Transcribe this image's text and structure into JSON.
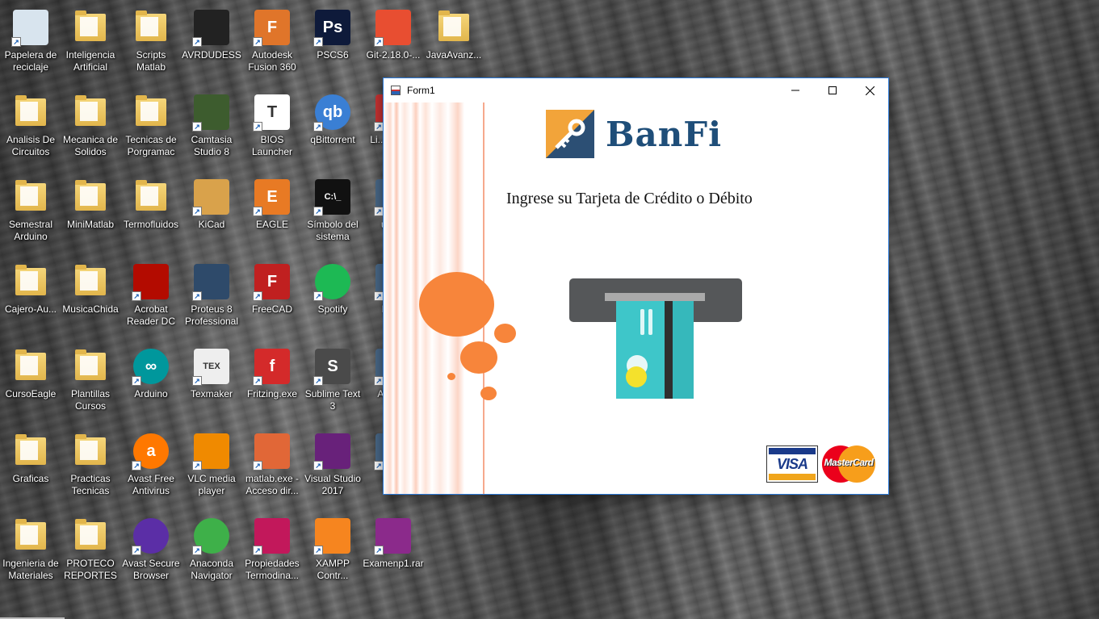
{
  "desktop": {
    "icons": [
      {
        "label": "Papelera de reciclaje",
        "icon": "recycle-bin-icon"
      },
      {
        "label": "Inteligencia Artificial",
        "icon": "folder-icon"
      },
      {
        "label": "Scripts Matlab",
        "icon": "folder-icon"
      },
      {
        "label": "AVRDUDESS",
        "icon": "chip-icon"
      },
      {
        "label": "Autodesk Fusion 360",
        "icon": "fusion360-icon",
        "glyph": "F"
      },
      {
        "label": "PSCS6",
        "icon": "photoshop-icon",
        "glyph": "Ps"
      },
      {
        "label": "Git-2.18.0-...",
        "icon": "git-icon"
      },
      {
        "label": "JavaAvanz...",
        "icon": "folder-icon"
      },
      {
        "label": "Analisis De Circuitos",
        "icon": "folder-icon"
      },
      {
        "label": "Mecanica de Solidos",
        "icon": "folder-icon"
      },
      {
        "label": "Tecnicas de Porgramac",
        "icon": "folder-icon"
      },
      {
        "label": "Camtasia Studio 8",
        "icon": "camtasia-icon"
      },
      {
        "label": "BIOS Launcher",
        "icon": "bios-launcher-icon",
        "glyph": "T"
      },
      {
        "label": "qBittorrent",
        "icon": "qbittorrent-icon",
        "glyph": "qb"
      },
      {
        "label": "Li... USB...",
        "icon": "usb-icon"
      },
      {
        "label": "Semestral Arduino",
        "icon": "folder-icon"
      },
      {
        "label": "MiniMatlab",
        "icon": "folder-icon"
      },
      {
        "label": "Termofluidos",
        "icon": "folder-icon"
      },
      {
        "label": "KiCad",
        "icon": "kicad-icon"
      },
      {
        "label": "EAGLE",
        "icon": "eagle-icon",
        "glyph": "E"
      },
      {
        "label": "Símbolo del sistema",
        "icon": "cmd-icon",
        "glyph": "C:\\_"
      },
      {
        "label": "une...",
        "icon": "app-icon"
      },
      {
        "label": "Cajero-Au...",
        "icon": "folder-icon"
      },
      {
        "label": "MusicaChida",
        "icon": "folder-icon"
      },
      {
        "label": "Acrobat Reader DC",
        "icon": "acrobat-icon"
      },
      {
        "label": "Proteus 8 Professional",
        "icon": "proteus-icon"
      },
      {
        "label": "FreeCAD",
        "icon": "freecad-icon",
        "glyph": "F"
      },
      {
        "label": "Spotify",
        "icon": "spotify-icon"
      },
      {
        "label": "Net...",
        "icon": "app-icon"
      },
      {
        "label": "CursoEagle",
        "icon": "folder-icon"
      },
      {
        "label": "Plantillas Cursos",
        "icon": "folder-icon"
      },
      {
        "label": "Arduino",
        "icon": "arduino-icon",
        "glyph": "∞"
      },
      {
        "label": "Texmaker",
        "icon": "texmaker-icon",
        "glyph": "TEX"
      },
      {
        "label": "Fritzing.exe",
        "icon": "fritzing-icon",
        "glyph": "f"
      },
      {
        "label": "Sublime Text 3",
        "icon": "sublime-icon",
        "glyph": "S"
      },
      {
        "label": "A... S...",
        "icon": "app-icon"
      },
      {
        "label": "Graficas",
        "icon": "folder-icon"
      },
      {
        "label": "Practicas Tecnicas",
        "icon": "folder-icon"
      },
      {
        "label": "Avast Free Antivirus",
        "icon": "avast-icon",
        "glyph": "a"
      },
      {
        "label": "VLC media player",
        "icon": "vlc-icon"
      },
      {
        "label": "matlab.exe - Acceso dir...",
        "icon": "matlab-icon"
      },
      {
        "label": "Visual Studio 2017",
        "icon": "visual-studio-icon"
      },
      {
        "label": "Ex...",
        "icon": "app-icon"
      },
      {
        "label": "Ingenieria de Materiales",
        "icon": "folder-icon"
      },
      {
        "label": "PROTECO REPORTES",
        "icon": "folder-icon"
      },
      {
        "label": "Avast Secure Browser",
        "icon": "avast-browser-icon"
      },
      {
        "label": "Anaconda Navigator",
        "icon": "anaconda-icon"
      },
      {
        "label": "Propiedades Termodina...",
        "icon": "propiedades-icon"
      },
      {
        "label": "XAMPP Contr...",
        "icon": "xampp-icon"
      },
      {
        "label": "Examenp1.rar",
        "icon": "winrar-icon"
      }
    ]
  },
  "window": {
    "title": "Form1",
    "controls": {
      "minimize": "—",
      "maximize": "☐",
      "close": "✕"
    },
    "brand": "BanFi",
    "prompt": "Ingrese su Tarjeta de Crédito  o Débito",
    "card_logos": {
      "visa": "VISA",
      "mastercard": "MasterCard"
    }
  },
  "colors": {
    "accent_orange": "#f7853b",
    "brand_blue": "#1f4e79",
    "window_border": "#2b79d8"
  }
}
